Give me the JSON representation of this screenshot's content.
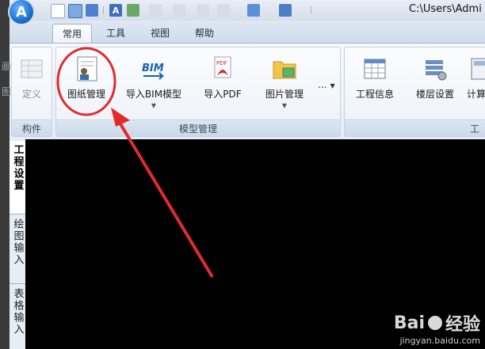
{
  "app": {
    "logo_letter": "A",
    "title_path": "C:\\Users\\Admi"
  },
  "tabs": [
    {
      "label": "常用",
      "active": true
    },
    {
      "label": "工具",
      "active": false
    },
    {
      "label": "视图",
      "active": false
    },
    {
      "label": "帮助",
      "active": false
    }
  ],
  "ribbon": {
    "left_fragments": [
      "画",
      "图"
    ],
    "group_component": {
      "label": "构件",
      "button_define": "定义"
    },
    "group_model": {
      "label": "模型管理",
      "button_drawing": "图纸管理",
      "button_import_bim": "导入BIM模型",
      "button_import_pdf": "导入PDF",
      "button_picture": "图片管理",
      "more_label": "...",
      "bim_icon_text": "BIM",
      "pdf_icon_text": "PDF"
    },
    "group_project": {
      "label": "工",
      "button_project_info": "工程信息",
      "button_floor_settings": "楼层设置",
      "button_calc": "计算"
    }
  },
  "side_tabs": [
    {
      "label": "工程设置",
      "active": true
    },
    {
      "label": "绘图输入",
      "active": false
    },
    {
      "label": "表格输入",
      "active": false
    }
  ],
  "watermark": {
    "brand_left": "Bai",
    "brand_right": "经验",
    "url": "jingyan.baidu.com"
  },
  "colors": {
    "annotation_red": "#e02b2b",
    "ribbon_border": "#9fb3cc",
    "accent_blue": "#1d6fd0"
  }
}
